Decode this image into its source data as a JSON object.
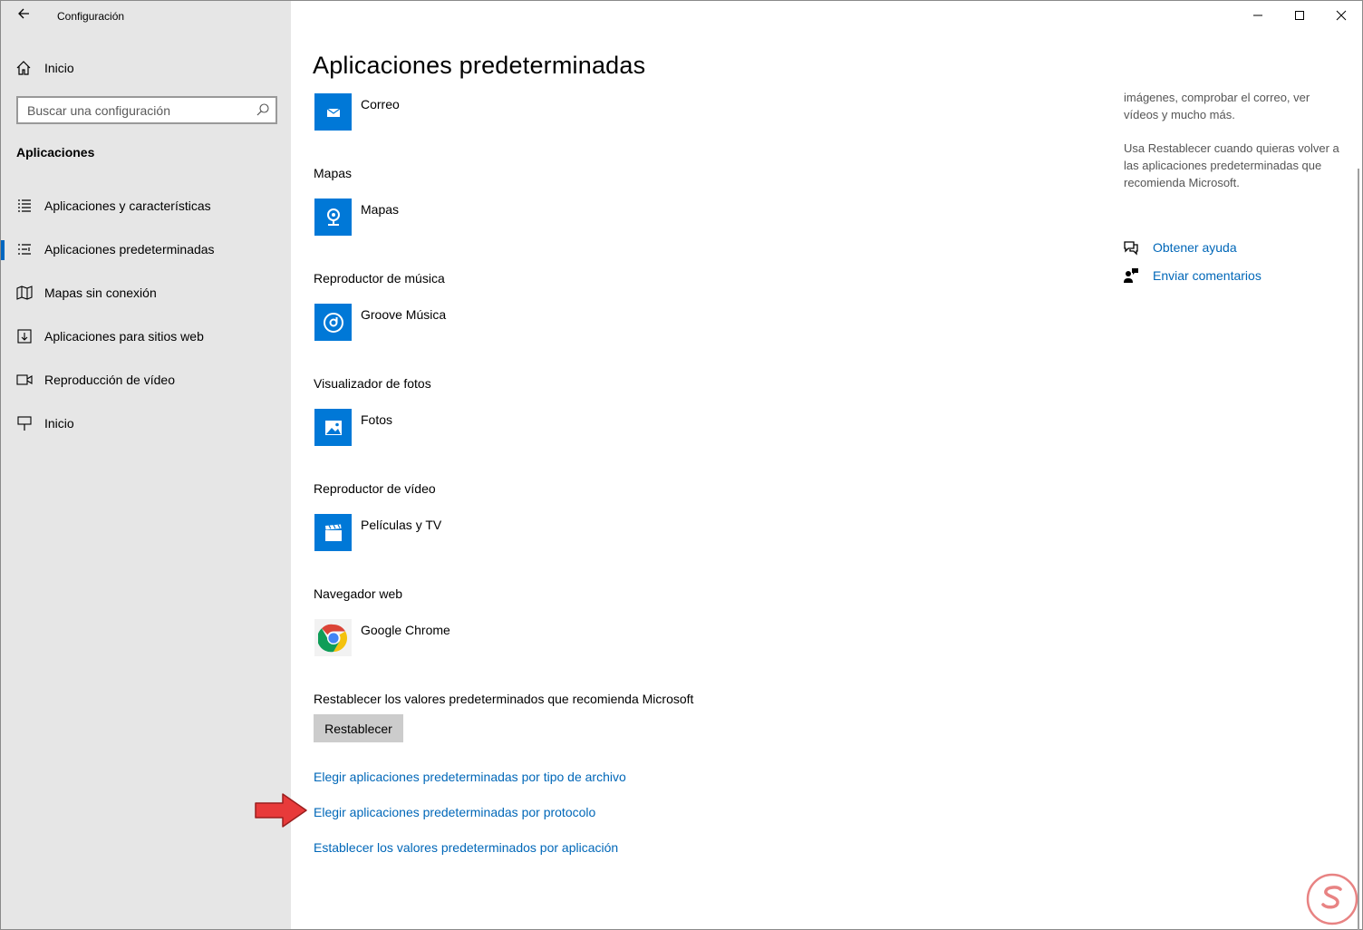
{
  "window": {
    "title": "Configuración"
  },
  "sidebar": {
    "home_label": "Inicio",
    "search_placeholder": "Buscar una configuración",
    "section_title": "Aplicaciones",
    "items": [
      {
        "label": "Aplicaciones y características",
        "icon": "list-icon"
      },
      {
        "label": "Aplicaciones predeterminadas",
        "icon": "default-apps-icon",
        "active": true
      },
      {
        "label": "Mapas sin conexión",
        "icon": "map-icon"
      },
      {
        "label": "Aplicaciones para sitios web",
        "icon": "web-apps-icon"
      },
      {
        "label": "Reproducción de vídeo",
        "icon": "video-icon"
      },
      {
        "label": "Inicio",
        "icon": "startup-icon"
      }
    ]
  },
  "main": {
    "title": "Aplicaciones predeterminadas",
    "groups": [
      {
        "label": "",
        "app": "Correo",
        "icon": "mail-icon"
      },
      {
        "label": "Mapas",
        "app": "Mapas",
        "icon": "maps-pin-icon"
      },
      {
        "label": "Reproductor de música",
        "app": "Groove Música",
        "icon": "groove-icon"
      },
      {
        "label": "Visualizador de fotos",
        "app": "Fotos",
        "icon": "photos-icon"
      },
      {
        "label": "Reproductor de vídeo",
        "app": "Películas y TV",
        "icon": "clapper-icon"
      },
      {
        "label": "Navegador web",
        "app": "Google Chrome",
        "icon": "chrome-icon"
      }
    ],
    "reset_label": "Restablecer los valores predeterminados que recomienda Microsoft",
    "reset_button": "Restablecer",
    "links": [
      "Elegir aplicaciones predeterminadas por tipo de archivo",
      "Elegir aplicaciones predeterminadas por protocolo",
      "Establecer los valores predeterminados por aplicación"
    ]
  },
  "aside": {
    "text1": "imágenes, comprobar el correo, ver vídeos y mucho más.",
    "text2": "Usa Restablecer cuando quieras volver a las aplicaciones predeterminadas que recomienda Microsoft.",
    "help_label": "Obtener ayuda",
    "feedback_label": "Enviar comentarios"
  },
  "colors": {
    "accent": "#0078d7",
    "link": "#0067b8",
    "sidebar_bg": "#e6e6e6",
    "arrow": "#e83a3a"
  }
}
